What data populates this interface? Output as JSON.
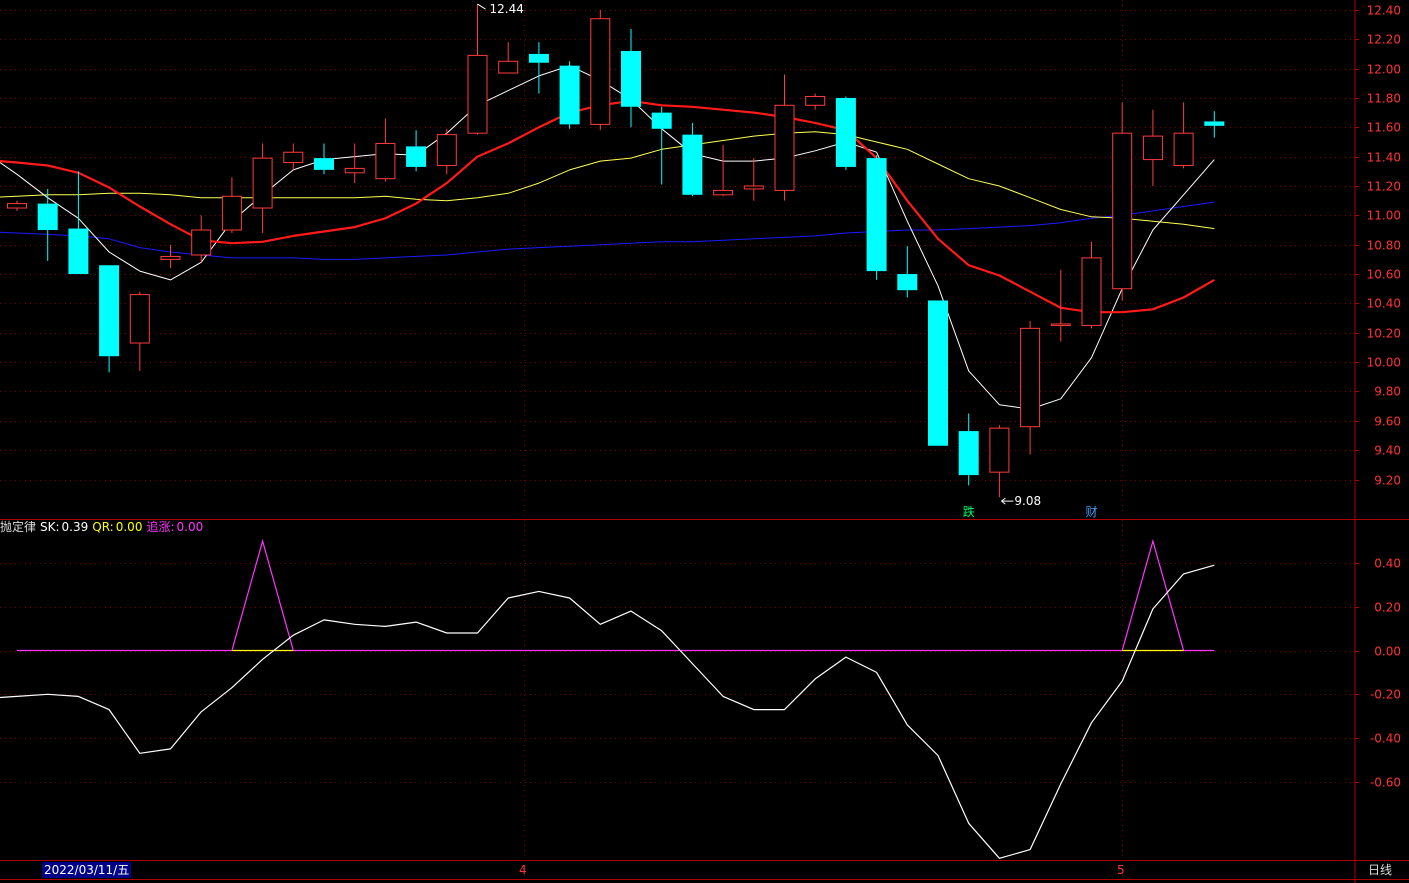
{
  "colors": {
    "background": "#000000",
    "frame": "#b00000",
    "grid": "#7a0000",
    "up": "#ff3b3b",
    "down": "#00ffff",
    "ma5": "#ffffff",
    "ma10": "#ff1a1a",
    "ma20": "#ffff55",
    "ma60": "#1a1aff",
    "sk": "#ffffff",
    "qr": "#ffff00",
    "zhuizhang": "#ff33ff"
  },
  "indicator": {
    "name": "抛定律",
    "sk_label": "SK:",
    "sk_value": "0.39",
    "qr_label": "QR:",
    "qr_value": "0.00",
    "zz_label": "追涨:",
    "zz_value": "0.00"
  },
  "footer": {
    "date": "2022/03/11/五",
    "month4": "4",
    "month5": "5",
    "period": "日线"
  },
  "chart_data": [
    {
      "type": "candlestick",
      "ylim": [
        9.0,
        12.5
      ],
      "y_ticks": [
        "12.40",
        "12.20",
        "12.00",
        "11.80",
        "11.60",
        "11.40",
        "11.20",
        "11.00",
        "10.80",
        "10.60",
        "10.40",
        "10.20",
        "10.00",
        "9.80",
        "9.60",
        "9.40",
        "9.20"
      ],
      "high_annotation": "12.44",
      "low_annotation": "9.08",
      "markers": [
        {
          "text": "跌",
          "index": 31,
          "color": "#00ff66"
        },
        {
          "text": "财",
          "index": 35,
          "color": "#4a9bff"
        }
      ],
      "candles": [
        {
          "o": 11.05,
          "h": 11.1,
          "l": 11.03,
          "c": 11.08
        },
        {
          "o": 11.08,
          "h": 11.18,
          "l": 10.69,
          "c": 10.9
        },
        {
          "o": 10.91,
          "h": 11.3,
          "l": 10.6,
          "c": 10.6
        },
        {
          "o": 10.66,
          "h": 10.66,
          "l": 9.93,
          "c": 10.04
        },
        {
          "o": 10.13,
          "h": 10.48,
          "l": 9.94,
          "c": 10.46
        },
        {
          "o": 10.7,
          "h": 10.8,
          "l": 10.64,
          "c": 10.72
        },
        {
          "o": 10.73,
          "h": 11.0,
          "l": 10.68,
          "c": 10.9
        },
        {
          "o": 10.9,
          "h": 11.26,
          "l": 10.88,
          "c": 11.13
        },
        {
          "o": 11.05,
          "h": 11.49,
          "l": 10.88,
          "c": 11.39
        },
        {
          "o": 11.36,
          "h": 11.49,
          "l": 11.31,
          "c": 11.43
        },
        {
          "o": 11.39,
          "h": 11.49,
          "l": 11.28,
          "c": 11.31
        },
        {
          "o": 11.29,
          "h": 11.49,
          "l": 11.22,
          "c": 11.32
        },
        {
          "o": 11.25,
          "h": 11.66,
          "l": 11.23,
          "c": 11.49
        },
        {
          "o": 11.47,
          "h": 11.58,
          "l": 11.3,
          "c": 11.33
        },
        {
          "o": 11.34,
          "h": 11.59,
          "l": 11.28,
          "c": 11.55
        },
        {
          "o": 11.56,
          "h": 12.44,
          "l": 11.55,
          "c": 12.09
        },
        {
          "o": 11.97,
          "h": 12.18,
          "l": 11.97,
          "c": 12.05
        },
        {
          "o": 12.1,
          "h": 12.18,
          "l": 11.83,
          "c": 12.04
        },
        {
          "o": 12.02,
          "h": 12.05,
          "l": 11.59,
          "c": 11.62
        },
        {
          "o": 11.62,
          "h": 12.4,
          "l": 11.58,
          "c": 12.34
        },
        {
          "o": 12.12,
          "h": 12.27,
          "l": 11.6,
          "c": 11.74
        },
        {
          "o": 11.7,
          "h": 11.74,
          "l": 11.21,
          "c": 11.59
        },
        {
          "o": 11.55,
          "h": 11.63,
          "l": 11.13,
          "c": 11.14
        },
        {
          "o": 11.14,
          "h": 11.48,
          "l": 11.13,
          "c": 11.17
        },
        {
          "o": 11.18,
          "h": 11.39,
          "l": 11.1,
          "c": 11.2
        },
        {
          "o": 11.17,
          "h": 11.96,
          "l": 11.1,
          "c": 11.75
        },
        {
          "o": 11.75,
          "h": 11.83,
          "l": 11.72,
          "c": 11.81
        },
        {
          "o": 11.8,
          "h": 11.81,
          "l": 11.31,
          "c": 11.33
        },
        {
          "o": 11.39,
          "h": 11.41,
          "l": 10.56,
          "c": 10.62
        },
        {
          "o": 10.6,
          "h": 10.79,
          "l": 10.44,
          "c": 10.49
        },
        {
          "o": 10.42,
          "h": 10.42,
          "l": 9.43,
          "c": 9.43
        },
        {
          "o": 9.53,
          "h": 9.65,
          "l": 9.16,
          "c": 9.23
        },
        {
          "o": 9.25,
          "h": 9.57,
          "l": 9.08,
          "c": 9.55
        },
        {
          "o": 9.56,
          "h": 10.28,
          "l": 9.37,
          "c": 10.23
        },
        {
          "o": 10.26,
          "h": 10.63,
          "l": 10.14,
          "c": 10.26
        },
        {
          "o": 10.25,
          "h": 10.82,
          "l": 10.23,
          "c": 10.71
        },
        {
          "o": 10.5,
          "h": 11.77,
          "l": 10.42,
          "c": 11.56
        },
        {
          "o": 11.38,
          "h": 11.72,
          "l": 11.2,
          "c": 11.54
        },
        {
          "o": 11.34,
          "h": 11.77,
          "l": 11.32,
          "c": 11.56
        },
        {
          "o": 11.64,
          "h": 11.71,
          "l": 11.53,
          "c": 11.61
        }
      ],
      "series": [
        {
          "name": "MA5",
          "values": [
            11.28,
            11.12,
            10.98,
            10.75,
            10.62,
            10.56,
            10.68,
            10.96,
            11.14,
            11.31,
            11.38,
            11.4,
            11.42,
            11.41,
            11.56,
            11.75,
            11.85,
            11.95,
            12.02,
            11.92,
            11.79,
            11.59,
            11.42,
            11.37,
            11.37,
            11.39,
            11.44,
            11.5,
            11.43,
            10.96,
            10.52,
            9.94,
            9.71,
            9.68,
            9.75,
            10.03,
            10.5,
            10.9,
            11.14,
            11.38
          ]
        },
        {
          "name": "MA10",
          "values": [
            11.36,
            11.34,
            11.29,
            11.19,
            11.06,
            10.94,
            10.83,
            10.81,
            10.82,
            10.86,
            10.89,
            10.92,
            10.98,
            11.08,
            11.22,
            11.4,
            11.49,
            11.6,
            11.7,
            11.75,
            11.78,
            11.75,
            11.74,
            11.72,
            11.7,
            11.67,
            11.63,
            11.58,
            11.39,
            11.1,
            10.84,
            10.66,
            10.59,
            10.48,
            10.37,
            10.34,
            10.34,
            10.36,
            10.44,
            10.56
          ]
        },
        {
          "name": "MA20",
          "values": [
            11.13,
            11.14,
            11.14,
            11.15,
            11.15,
            11.14,
            11.12,
            11.12,
            11.12,
            11.12,
            11.12,
            11.12,
            11.13,
            11.11,
            11.1,
            11.12,
            11.15,
            11.22,
            11.31,
            11.37,
            11.39,
            11.45,
            11.48,
            11.51,
            11.54,
            11.56,
            11.57,
            11.55,
            11.5,
            11.45,
            11.35,
            11.25,
            11.2,
            11.12,
            11.04,
            10.99,
            10.98,
            10.96,
            10.94,
            10.91
          ]
        },
        {
          "name": "MA60",
          "values": [
            10.88,
            10.87,
            10.86,
            10.84,
            10.78,
            10.75,
            10.73,
            10.71,
            10.71,
            10.71,
            10.7,
            10.7,
            10.71,
            10.72,
            10.73,
            10.75,
            10.77,
            10.78,
            10.79,
            10.8,
            10.81,
            10.82,
            10.82,
            10.83,
            10.84,
            10.85,
            10.86,
            10.88,
            10.89,
            10.9,
            10.9,
            10.91,
            10.92,
            10.93,
            10.95,
            10.98,
            11.0,
            11.03,
            11.06,
            11.09
          ]
        }
      ]
    },
    {
      "type": "line",
      "ylim": [
        -0.95,
        0.55
      ],
      "y_ticks": [
        "0.40",
        "0.20",
        "0.00",
        "-0.20",
        "-0.40",
        "-0.60"
      ],
      "series": [
        {
          "name": "SK",
          "values": [
            -0.21,
            -0.2,
            -0.21,
            -0.27,
            -0.47,
            -0.45,
            -0.28,
            -0.17,
            -0.04,
            0.07,
            0.14,
            0.12,
            0.11,
            0.13,
            0.08,
            0.08,
            0.24,
            0.27,
            0.24,
            0.12,
            0.18,
            0.09,
            -0.06,
            -0.21,
            -0.27,
            -0.27,
            -0.13,
            -0.03,
            -0.1,
            -0.34,
            -0.48,
            -0.79,
            -0.95,
            -0.91,
            -0.61,
            -0.33,
            -0.14,
            0.19,
            0.35,
            0.39
          ]
        },
        {
          "name": "QR",
          "values": [
            0,
            0,
            0,
            0,
            0,
            0,
            0,
            0,
            0,
            0,
            0,
            0,
            0,
            0,
            0,
            0,
            0,
            0,
            0,
            0,
            0,
            0,
            0,
            0,
            0,
            0,
            0,
            0,
            0,
            0,
            0,
            0,
            0,
            0,
            0,
            0,
            0,
            0,
            0,
            0
          ]
        },
        {
          "name": "追涨",
          "values": [
            0,
            0,
            0,
            0,
            0,
            0,
            0,
            0,
            0.5,
            0,
            0,
            0,
            0,
            0,
            0,
            0,
            0,
            0,
            0,
            0,
            0,
            0,
            0,
            0,
            0,
            0,
            0,
            0,
            0,
            0,
            0,
            0,
            0,
            0,
            0,
            0,
            0,
            0.5,
            0,
            0
          ]
        }
      ]
    }
  ]
}
